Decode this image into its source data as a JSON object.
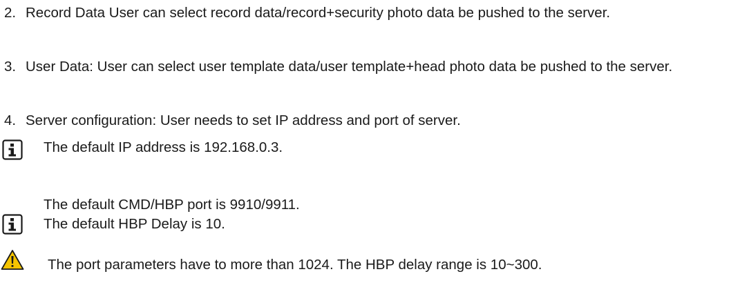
{
  "items": [
    {
      "number": "2.",
      "text": "Record Data User can select record data/record+security photo data be pushed to the server."
    },
    {
      "number": "3.",
      "text": "User Data: User can select user template data/user template+head photo data be pushed to the server."
    },
    {
      "number": "4.",
      "text": "Server configuration: User needs to set IP address and port of server."
    }
  ],
  "notes": {
    "default_ip": "The default IP address is 192.168.0.3.",
    "default_port": "The default CMD/HBP port is 9910/9911.",
    "default_delay": "The default HBP Delay is 10."
  },
  "warning": {
    "text": "The port parameters have to more than 1024. The HBP delay range is 10~300."
  },
  "icons": {
    "info": "info-icon",
    "warning": "warning-icon",
    "warning_color": "#f5c400"
  }
}
